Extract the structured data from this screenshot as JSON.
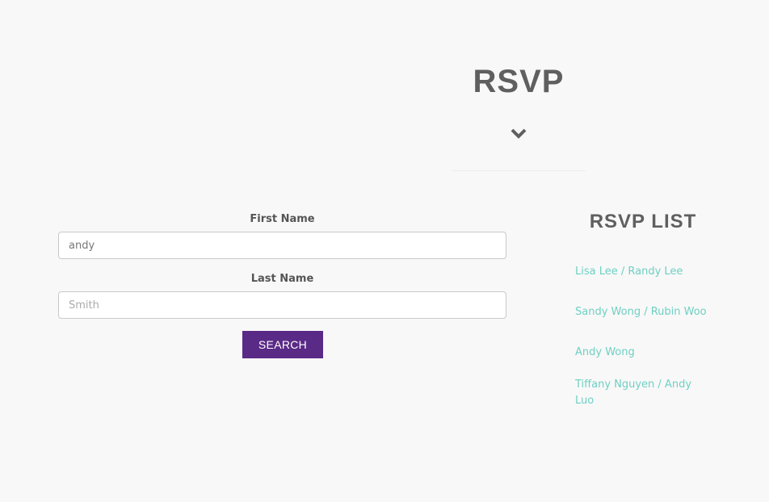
{
  "header": {
    "title": "RSVP"
  },
  "form": {
    "first_name": {
      "label": "First Name",
      "value": "andy",
      "placeholder": ""
    },
    "last_name": {
      "label": "Last Name",
      "value": "",
      "placeholder": "Smith"
    },
    "search_label": "SEARCH"
  },
  "rsvp_list": {
    "title": "RSVP LIST",
    "entries": [
      "Lisa Lee / Randy Lee",
      "Sandy Wong / Rubin Woo",
      "Andy Wong",
      "Tiffany Nguyen / Andy Luo"
    ]
  },
  "colors": {
    "background": "#f8f8f8",
    "heading": "#5f5f5f",
    "button": "#5a2a87",
    "link": "#6fd0c3"
  },
  "icons": {
    "section_toggle": "chevron-down-icon"
  }
}
